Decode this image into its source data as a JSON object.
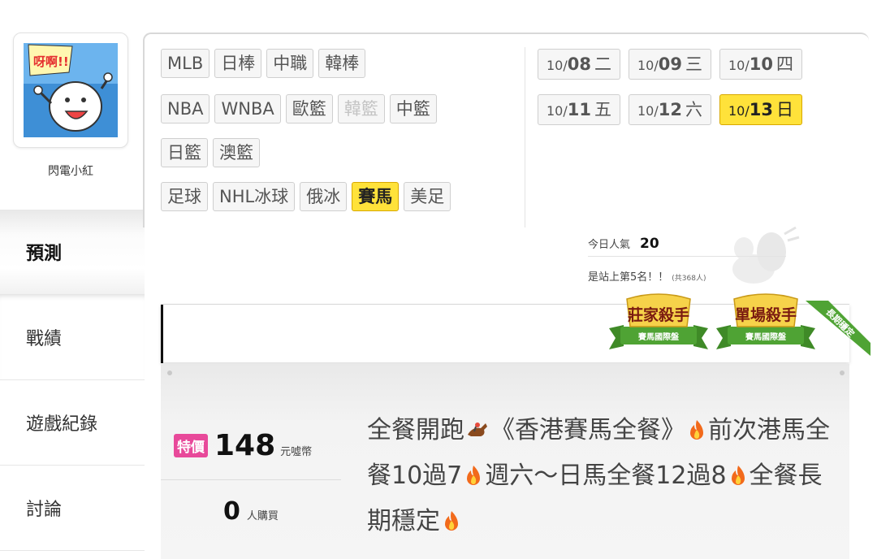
{
  "user": {
    "name": "閃電小紅",
    "avatar_shout": "呀啊!!"
  },
  "nav": {
    "items": [
      "預測",
      "戰績",
      "遊戲紀錄",
      "討論"
    ],
    "active_index": 0
  },
  "sports": {
    "rows": [
      [
        "MLB",
        "日棒",
        "中職",
        "韓棒"
      ],
      [
        "NBA",
        "WNBA",
        "歐籃",
        "韓籃",
        "中籃"
      ],
      [
        "日籃",
        "澳籃"
      ],
      [
        "足球",
        "NHL冰球",
        "俄冰",
        "賽馬",
        "美足"
      ]
    ],
    "disabled": [
      "韓籃"
    ],
    "selected": "賽馬"
  },
  "dates": {
    "rows": [
      [
        {
          "md": "10/",
          "d": "08",
          "wd": "二"
        },
        {
          "md": "10/",
          "d": "09",
          "wd": "三"
        },
        {
          "md": "10/",
          "d": "10",
          "wd": "四"
        }
      ],
      [
        {
          "md": "10/",
          "d": "11",
          "wd": "五"
        },
        {
          "md": "10/",
          "d": "12",
          "wd": "六"
        },
        {
          "md": "10/",
          "d": "13",
          "wd": "日"
        }
      ]
    ],
    "selected": "13"
  },
  "popularity": {
    "label": "今日人氣",
    "value": "20",
    "rank_text": "是站上第5名！！",
    "total_text": "(共368人)"
  },
  "badges": [
    {
      "title": "莊家殺手",
      "sub": "賽馬國際盤"
    },
    {
      "title": "單場殺手",
      "sub": "賽馬國際盤"
    }
  ],
  "ribbon": "長期穩定",
  "product": {
    "tag": "特價",
    "price": "148",
    "currency": "元噓幣",
    "buyers": "0",
    "buyers_unit": "人購買",
    "title_parts": [
      "全餐開跑",
      "《香港賽馬全餐》",
      "前次港馬全餐10過7",
      "週六～日馬全餐12過8",
      "全餐長期穩定"
    ]
  },
  "colors": {
    "accent_yellow": "#ffe23a",
    "tag_pink": "#e8499a",
    "badge_green": "#4a9a2e",
    "badge_gold": "#f2c23a"
  }
}
